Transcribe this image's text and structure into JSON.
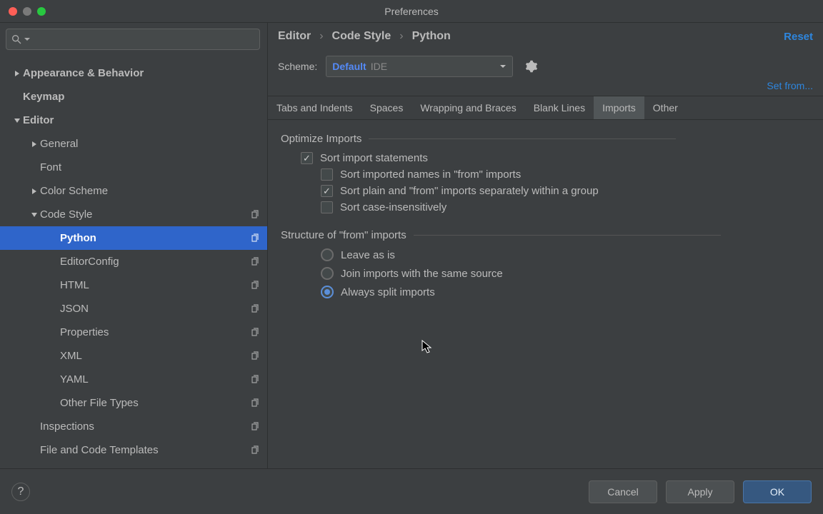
{
  "title": "Preferences",
  "search": {
    "placeholder": ""
  },
  "sidebar": {
    "items": [
      {
        "label": "Appearance & Behavior"
      },
      {
        "label": "Keymap"
      },
      {
        "label": "Editor"
      },
      {
        "label": "General"
      },
      {
        "label": "Font"
      },
      {
        "label": "Color Scheme"
      },
      {
        "label": "Code Style"
      },
      {
        "label": "Python"
      },
      {
        "label": "EditorConfig"
      },
      {
        "label": "HTML"
      },
      {
        "label": "JSON"
      },
      {
        "label": "Properties"
      },
      {
        "label": "XML"
      },
      {
        "label": "YAML"
      },
      {
        "label": "Other File Types"
      },
      {
        "label": "Inspections"
      },
      {
        "label": "File and Code Templates"
      }
    ]
  },
  "breadcrumb": {
    "a": "Editor",
    "b": "Code Style",
    "c": "Python"
  },
  "reset": "Reset",
  "scheme": {
    "label": "Scheme:",
    "name": "Default",
    "tag": "IDE"
  },
  "set_from": "Set from...",
  "tabs": [
    "Tabs and Indents",
    "Spaces",
    "Wrapping and Braces",
    "Blank Lines",
    "Imports",
    "Other"
  ],
  "sections": {
    "optimize": {
      "title": "Optimize Imports",
      "sort_statements": "Sort import statements",
      "sort_names_from": "Sort imported names in \"from\" imports",
      "sort_plain_from": "Sort plain and \"from\" imports separately within a group",
      "sort_case_insensitive": "Sort case-insensitively"
    },
    "structure": {
      "title": "Structure of \"from\" imports",
      "leave": "Leave as is",
      "join": "Join imports with the same source",
      "split": "Always split imports"
    }
  },
  "footer": {
    "cancel": "Cancel",
    "apply": "Apply",
    "ok": "OK",
    "help": "?"
  }
}
